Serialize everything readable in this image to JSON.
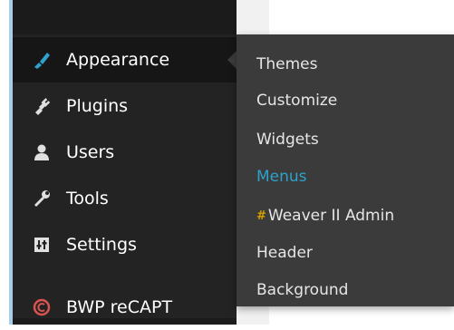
{
  "sidebar": {
    "items": [
      {
        "label": "Appearance",
        "icon": "paintbrush-icon",
        "active": true
      },
      {
        "label": "Plugins",
        "icon": "plug-icon"
      },
      {
        "label": "Users",
        "icon": "user-icon"
      },
      {
        "label": "Tools",
        "icon": "wrench-icon"
      },
      {
        "label": "Settings",
        "icon": "settings-sliders-icon"
      },
      {
        "label": "BWP reCAPT",
        "icon": "bwp-recaptcha-icon"
      }
    ]
  },
  "flyout": {
    "items": [
      {
        "label": "Themes"
      },
      {
        "label": "Customize"
      },
      {
        "label": "Widgets"
      },
      {
        "label": "Menus",
        "current": true
      },
      {
        "label": "Weaver II Admin",
        "icon": "weaver-icon"
      },
      {
        "label": "Header"
      },
      {
        "label": "Background"
      }
    ]
  },
  "colors": {
    "sidebar_bg": "#232323",
    "flyout_bg": "#3b3b3b",
    "active_item_bg": "#161616",
    "current_submenu": "#2ea2cc",
    "left_accent": "#a9cde6",
    "icon_blue": "#2ea2cc",
    "bwp_red": "#d9534f"
  }
}
